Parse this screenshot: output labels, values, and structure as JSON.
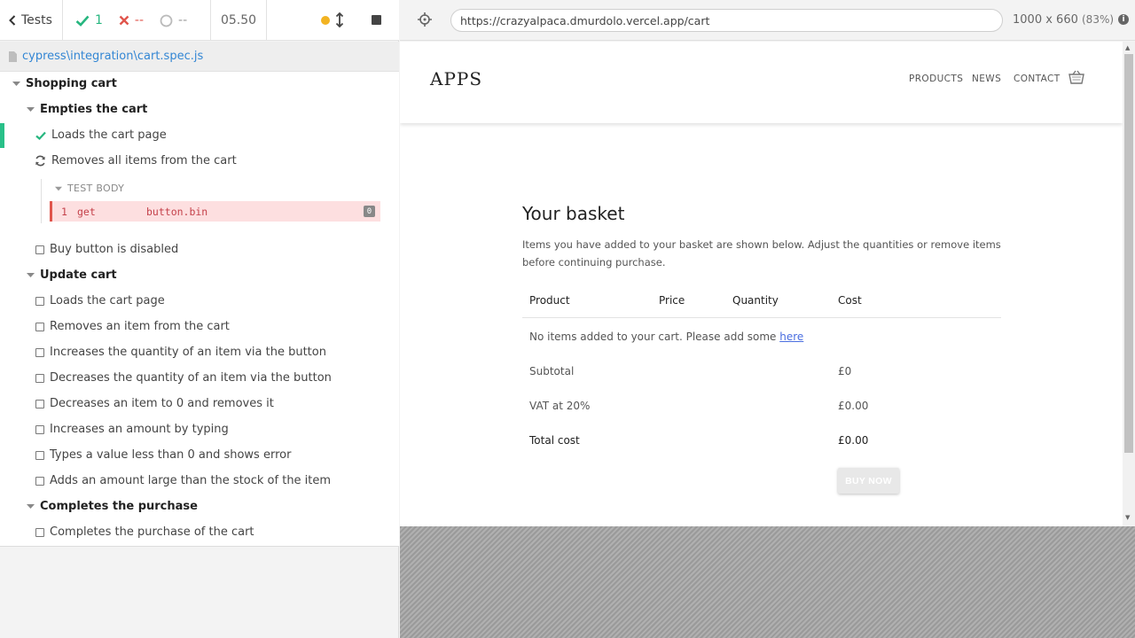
{
  "runner": {
    "back_label": "Tests",
    "passed": "1",
    "failed": "--",
    "pending": "--",
    "duration": "05.50",
    "spec_path": "cypress\\integration\\cart.spec.js",
    "tree": {
      "suite1": "Shopping cart",
      "suite1a": "Empties the cart",
      "t1": "Loads the cart page",
      "t2": "Removes all items from the cart",
      "test_body": "TEST BODY",
      "cmd": {
        "num": "1",
        "name": "get",
        "msg": "button.bin",
        "badge": "0"
      },
      "t3": "Buy button is disabled",
      "suite1b": "Update cart",
      "t4": "Loads the cart page",
      "t5": "Removes an item from the cart",
      "t6": "Increases the quantity of an item via the button",
      "t7": "Decreases the quantity of an item via the button",
      "t8": "Decreases an item to 0 and removes it",
      "t9": "Increases an amount by typing",
      "t10": "Types a value less than 0 and shows error",
      "t11": "Adds an amount large than the stock of the item",
      "suite1c": "Completes the purchase",
      "t12": "Completes the purchase of the cart"
    }
  },
  "aut": {
    "url": "https://crazyalpaca.dmurdolo.vercel.app/cart",
    "viewport": "1000 x 660",
    "scale": "(83%)",
    "site": {
      "logo": "APPS",
      "nav": [
        "PRODUCTS",
        "NEWS",
        "CONTACT"
      ],
      "title": "Your basket",
      "description": "Items you have added to your basket are shown below. Adjust the quantities or remove items before continuing purchase.",
      "columns": [
        "Product",
        "Price",
        "Quantity",
        "Cost"
      ],
      "empty_text": "No items added to your cart. Please add some ",
      "empty_link": "here",
      "subtotal_label": "Subtotal",
      "subtotal_value": "£0",
      "vat_label": "VAT at 20%",
      "vat_value": "£0.00",
      "total_label": "Total cost",
      "total_value": "£0.00",
      "buy_label": "BUY NOW"
    }
  },
  "colors": {
    "pass": "#26b67f",
    "fail": "#e0554c",
    "accent": "#3386d4"
  }
}
